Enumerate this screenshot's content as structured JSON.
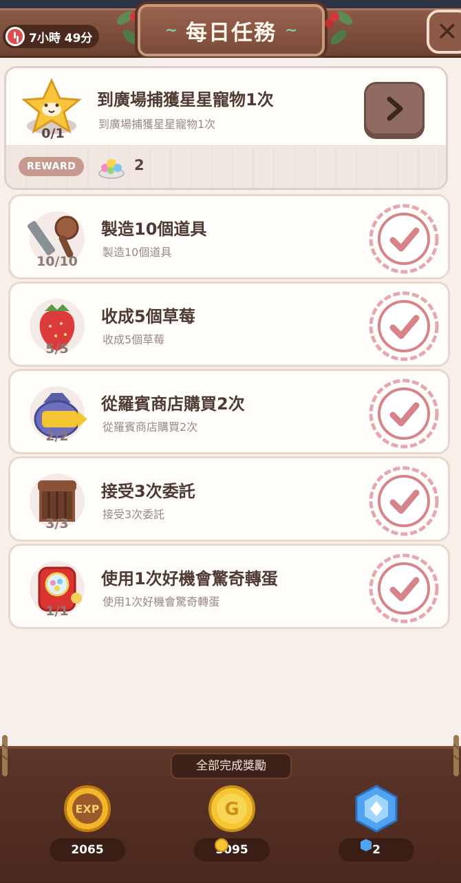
{
  "header": {
    "timer": "7小時 49分",
    "title": "每日任務",
    "close_symbol": "✕"
  },
  "active_quest": {
    "title": "到廣場捕獲星星寵物1次",
    "subtitle": "到廣場捕獲星星寵物1次",
    "progress": "0/1",
    "reward_label": "REWARD",
    "reward_count": "2",
    "icon": "star-pet-icon"
  },
  "completed_quests": [
    {
      "title": "製造10個道具",
      "subtitle": "製造10個道具",
      "progress": "10/10",
      "icon": "crafting-tools-icon"
    },
    {
      "title": "收成5個草莓",
      "subtitle": "收成5個草莓",
      "progress": "5/5",
      "icon": "strawberry-icon"
    },
    {
      "title": "從羅賓商店購買2次",
      "subtitle": "從羅賓商店購買2次",
      "progress": "2/2",
      "icon": "gold-bag-icon"
    },
    {
      "title": "接受3次委託",
      "subtitle": "接受3次委託",
      "progress": "3/3",
      "icon": "request-board-icon"
    },
    {
      "title": "使用1次好機會驚奇轉蛋",
      "subtitle": "使用1次好機會驚奇轉蛋",
      "progress": "1/1",
      "icon": "gacha-machine-icon"
    }
  ],
  "footer": {
    "label": "全部完成獎勵",
    "rewards": [
      {
        "type": "exp",
        "icon": "exp-coin-icon",
        "amount": "2065"
      },
      {
        "type": "gold",
        "icon": "gold-coin-icon",
        "amount": "3095"
      },
      {
        "type": "gem",
        "icon": "blue-gem-icon",
        "amount": "2"
      }
    ]
  },
  "colors": {
    "header_brown": "#8c5a47",
    "panel_bg": "#f6efea",
    "stamp_pink": "#d7838a",
    "footer_brown": "#4a271d"
  }
}
